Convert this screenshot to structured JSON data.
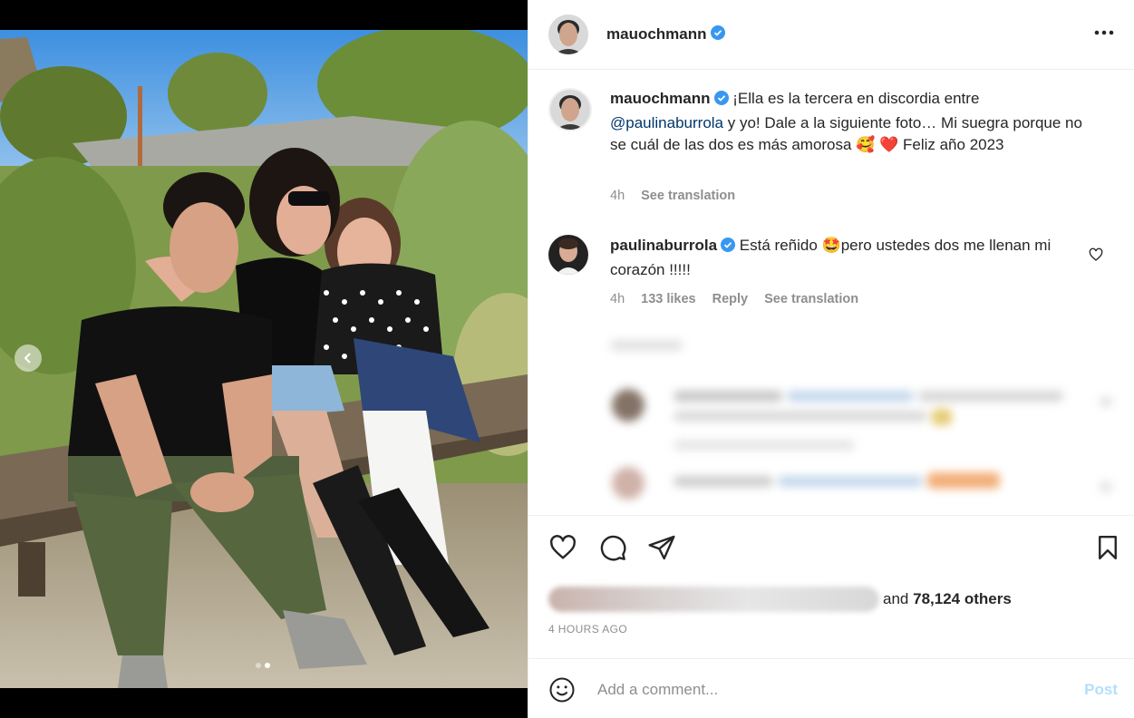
{
  "post": {
    "author": "mauochmann",
    "more_label": "•••"
  },
  "caption": {
    "author": "mauochmann",
    "text_1": "¡Ella es la tercera en discordia entre",
    "mention": "@paulinaburrola",
    "text_2": " y yo! Dale a la siguiente foto… Mi suegra porque no se cuál de las dos es más amorosa ",
    "emoji_1": "🥰",
    "emoji_2": "❤️",
    "text_3": " Feliz año 2023",
    "time": "4h",
    "see_translation": "See translation"
  },
  "reply": {
    "author": "paulinaburrola",
    "text_1": " Está reñido ",
    "emoji": "🤩",
    "text_2": "pero ustedes dos me llenan mi corazón !!!!!",
    "time": "4h",
    "likes": "133 likes",
    "reply_label": "Reply",
    "see_translation": "See translation"
  },
  "likes": {
    "suffix": "and",
    "count_text": "78,124 others"
  },
  "timestamp": "4 HOURS AGO",
  "composer": {
    "placeholder": "Add a comment...",
    "post_label": "Post"
  },
  "colors": {
    "verified": "#3897f0",
    "link": "#00376b",
    "muted": "#8e8e8e",
    "post_disabled": "#b2dffc"
  }
}
